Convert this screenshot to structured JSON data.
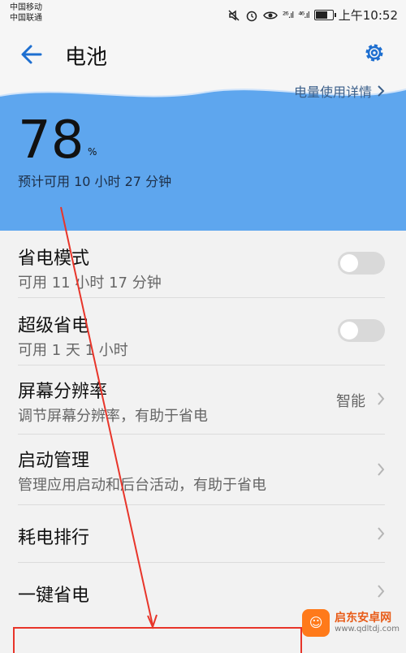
{
  "status_bar": {
    "carrier1": "中国移动",
    "carrier2": "中国联通",
    "signal1": "²⁶.ıl",
    "signal2": "⁴⁶.ıl",
    "time": "上午10:52",
    "battery_level": 0.78
  },
  "app_bar": {
    "title": "电池"
  },
  "hero": {
    "details_link": "电量使用详情",
    "percent": "78",
    "percent_unit": "%",
    "estimate": "预计可用 10 小时 27 分钟",
    "color": "#5ea6ee"
  },
  "settings": {
    "power_saving": {
      "label": "省电模式",
      "sub": "可用 11 小时 17 分钟",
      "enabled": false
    },
    "ultra_saving": {
      "label": "超级省电",
      "sub": "可用 1 天 1 小时",
      "enabled": false
    },
    "resolution": {
      "label": "屏幕分辨率",
      "sub": "调节屏幕分辨率，有助于省电",
      "value": "智能"
    },
    "startup": {
      "label": "启动管理",
      "sub": "管理应用启动和后台活动，有助于省电"
    },
    "ranking": {
      "label": "耗电排行"
    },
    "optimize": {
      "label": "一键省电"
    }
  },
  "annotation": {
    "color": "#e8352a"
  },
  "watermark": {
    "title": "启东安卓网",
    "url": "www.qdltdj.com"
  }
}
